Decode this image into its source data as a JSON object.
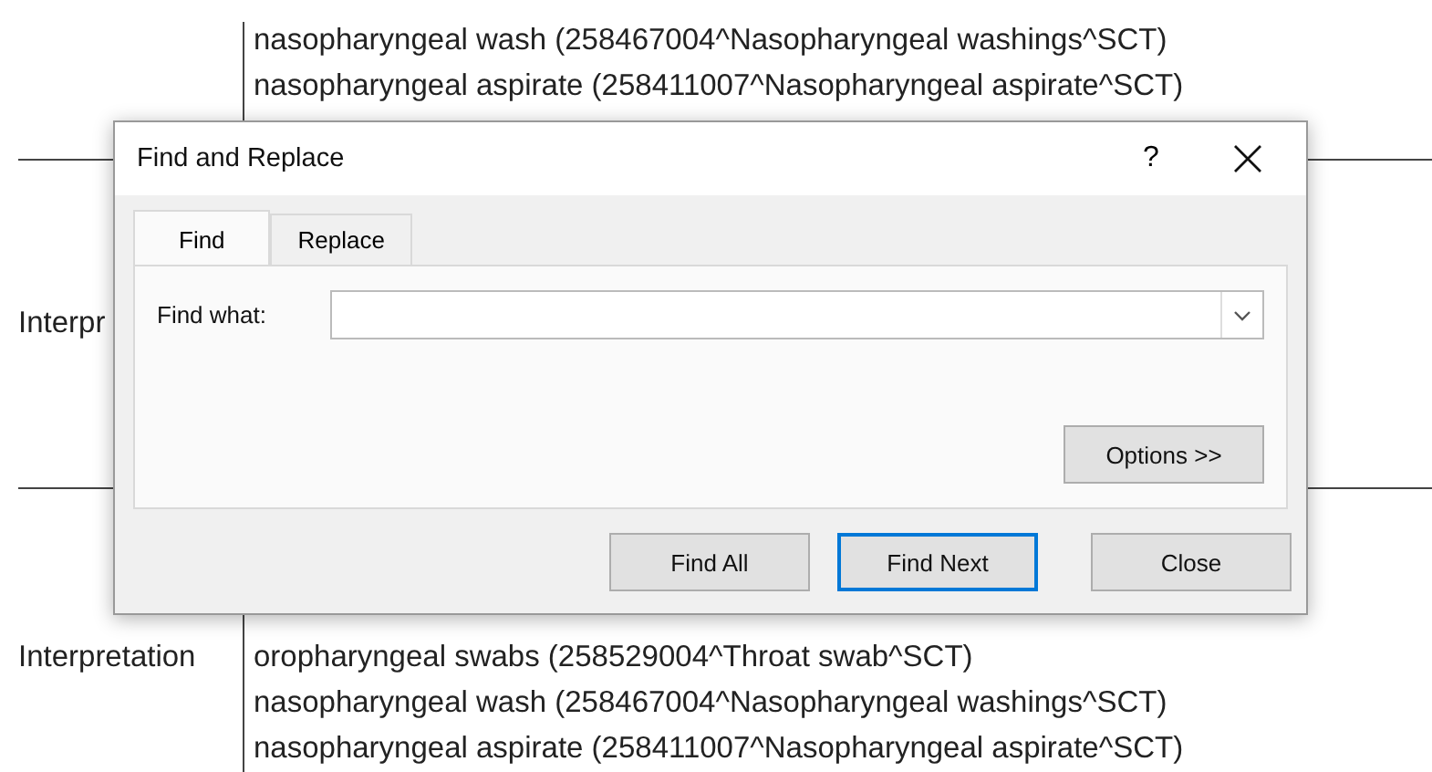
{
  "document": {
    "sections": [
      {
        "lines": [
          "nasopharyngeal wash (258467004^Nasopharyngeal washings^SCT)",
          "nasopharyngeal aspirate (258411007^Nasopharyngeal aspirate^SCT)"
        ]
      },
      {
        "label": "Interpr"
      },
      {
        "label": "Interpretation",
        "lines": [
          "oropharyngeal swabs (258529004^Throat swab^SCT)",
          "nasopharyngeal wash (258467004^Nasopharyngeal washings^SCT)",
          "nasopharyngeal aspirate (258411007^Nasopharyngeal aspirate^SCT)"
        ]
      }
    ]
  },
  "dialog": {
    "title": "Find and Replace",
    "help": "?",
    "tabs": [
      {
        "label": "Find",
        "selected": true
      },
      {
        "label": "Replace",
        "selected": false
      }
    ],
    "find_what": {
      "label": "Find what:"
    },
    "options_button": "Options >>",
    "buttons": [
      {
        "label": "Find All",
        "default": false
      },
      {
        "label": "Find Next",
        "default": true
      },
      {
        "label": "Close",
        "default": false
      }
    ]
  }
}
